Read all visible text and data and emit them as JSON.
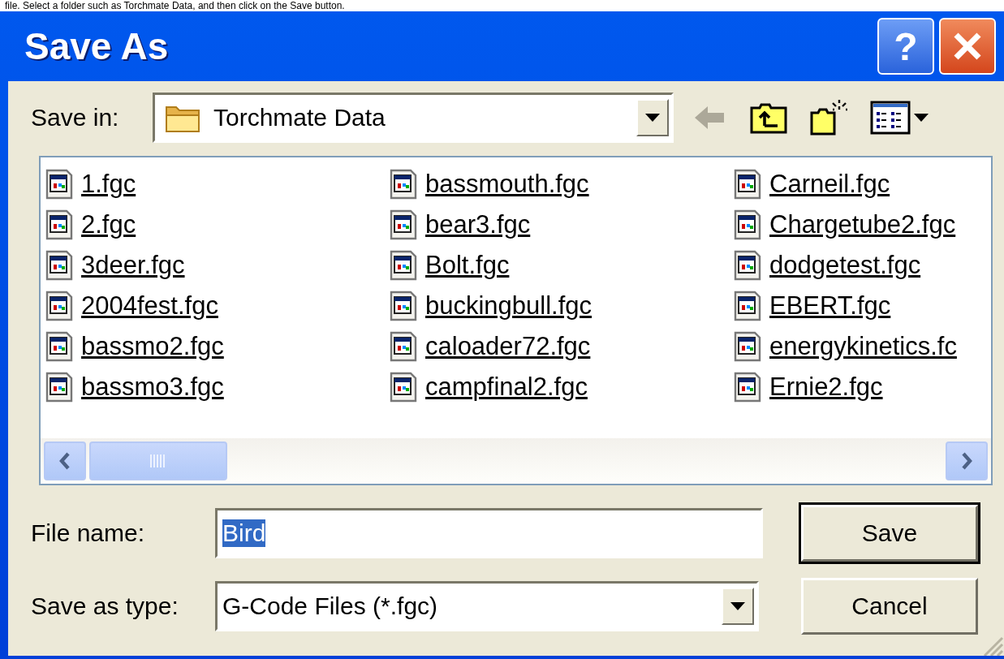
{
  "caption": "file. Select a folder such as Torchmate Data, and then click on the Save button.",
  "window": {
    "title": "Save As",
    "help": "?"
  },
  "save_in": {
    "label": "Save in:",
    "value": "Torchmate Data"
  },
  "toolbar": [
    {
      "kind": "back",
      "disabled": true
    },
    {
      "kind": "up",
      "disabled": false
    },
    {
      "kind": "new-folder",
      "disabled": false
    },
    {
      "kind": "views",
      "disabled": false
    }
  ],
  "files": [
    "1.fgc",
    "2.fgc",
    "3deer.fgc",
    "2004fest.fgc",
    "bassmo2.fgc",
    "bassmo3.fgc",
    "bassmouth.fgc",
    "bear3.fgc",
    "Bolt.fgc",
    "buckingbull.fgc",
    "caloader72.fgc",
    "campfinal2.fgc",
    "Carneil.fgc",
    "Chargetube2.fgc",
    "dodgetest.fgc",
    "EBERT.fgc",
    "energykinetics.fc",
    "Ernie2.fgc"
  ],
  "file_name": {
    "label": "File name:",
    "value": "Bird",
    "selected": true
  },
  "save_as_type": {
    "label": "Save as type:",
    "value": "G-Code Files (*.fgc)"
  },
  "buttons": [
    {
      "label": "Save",
      "default": true
    },
    {
      "label": "Cancel",
      "default": false
    }
  ]
}
